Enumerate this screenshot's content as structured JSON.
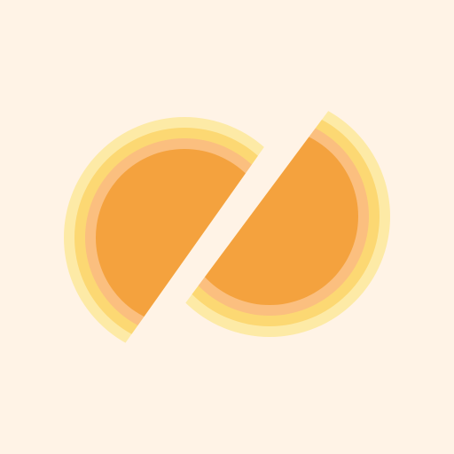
{
  "icon": {
    "name": "split-orange-logo-icon"
  },
  "colors": {
    "background": "#fff3e6",
    "ring_outer": "#fdeaa6",
    "ring_mid": "#fcd873",
    "ring_inner": "#fbbf7f",
    "core": "#f4a23e",
    "gap": "#fff3e6"
  }
}
